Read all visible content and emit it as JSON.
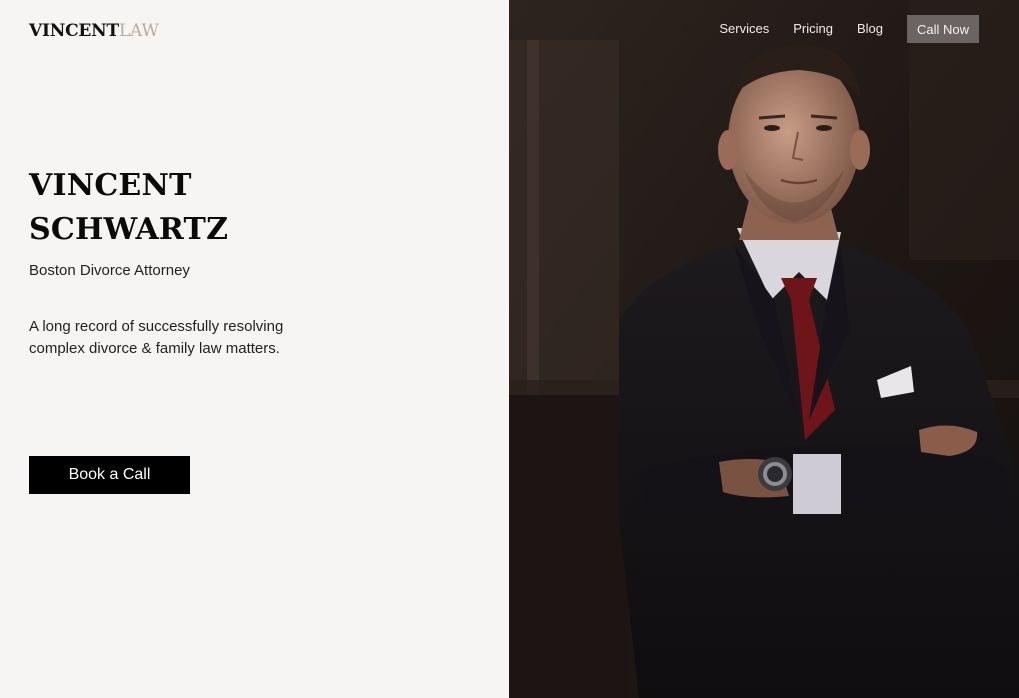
{
  "brand": {
    "name_bold": "VINCENT",
    "name_light": "LAW",
    "accent_color": "#b8aca2"
  },
  "nav": {
    "items": [
      {
        "label": "Services"
      },
      {
        "label": "Pricing"
      },
      {
        "label": "Blog"
      }
    ],
    "cta_label": "Call Now"
  },
  "hero": {
    "title_line1": "VINCENT",
    "title_line2": "SCHWARTZ",
    "subtitle": "Boston Divorce Attorney",
    "description": "A long record of successfully resolving complex divorce & family law matters.",
    "button_label": "Book a Call"
  },
  "colors": {
    "left_background": "#f7f5f3",
    "button_background": "#000000",
    "nav_cta_background": "#6a6462"
  }
}
